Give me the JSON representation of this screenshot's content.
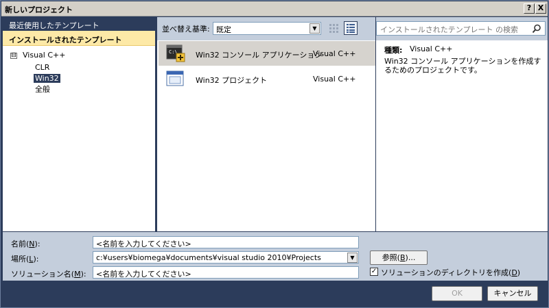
{
  "window": {
    "title": "新しいプロジェクト",
    "help": "?",
    "close": "X"
  },
  "left": {
    "recent": "最近使用したテンプレート",
    "installed": "インストールされたテンプレート",
    "tree": {
      "expander": "⊟",
      "root": "Visual C++",
      "children": [
        "CLR",
        "Win32",
        "全般"
      ]
    }
  },
  "middle": {
    "sort_label": "並べ替え基準:",
    "sort_value": "既定",
    "items": [
      {
        "name": "Win32 コンソール アプリケーション",
        "lang": "Visual C++",
        "icon": "console-app-icon"
      },
      {
        "name": "Win32 プロジェクト",
        "lang": "Visual C++",
        "icon": "win32-project-icon"
      }
    ]
  },
  "right": {
    "search_placeholder": "インストールされたテンプレート の検索",
    "kind_label": "種類:",
    "kind_value": "Visual C++",
    "description": "Win32 コンソール アプリケーションを作成するためのプロジェクトです。"
  },
  "form": {
    "name_label": "名前(",
    "name_key": "N",
    "name_tail": "):",
    "name_value": "<名前を入力してください>",
    "loc_label": "場所(",
    "loc_key": "L",
    "loc_tail": "):",
    "loc_value": "c:¥users¥biomega¥documents¥visual studio 2010¥Projects",
    "sol_label": "ソリューション名(",
    "sol_key": "M",
    "sol_tail": "):",
    "sol_value": "<名前を入力してください>",
    "browse_label": "参照(",
    "browse_key": "B",
    "browse_tail": ")...",
    "checkbox_label": "ソリューションのディレクトリを作成(",
    "checkbox_key": "D",
    "checkbox_tail": ")",
    "checkbox_checked": true
  },
  "buttons": {
    "ok": "OK",
    "cancel": "キャンセル"
  }
}
